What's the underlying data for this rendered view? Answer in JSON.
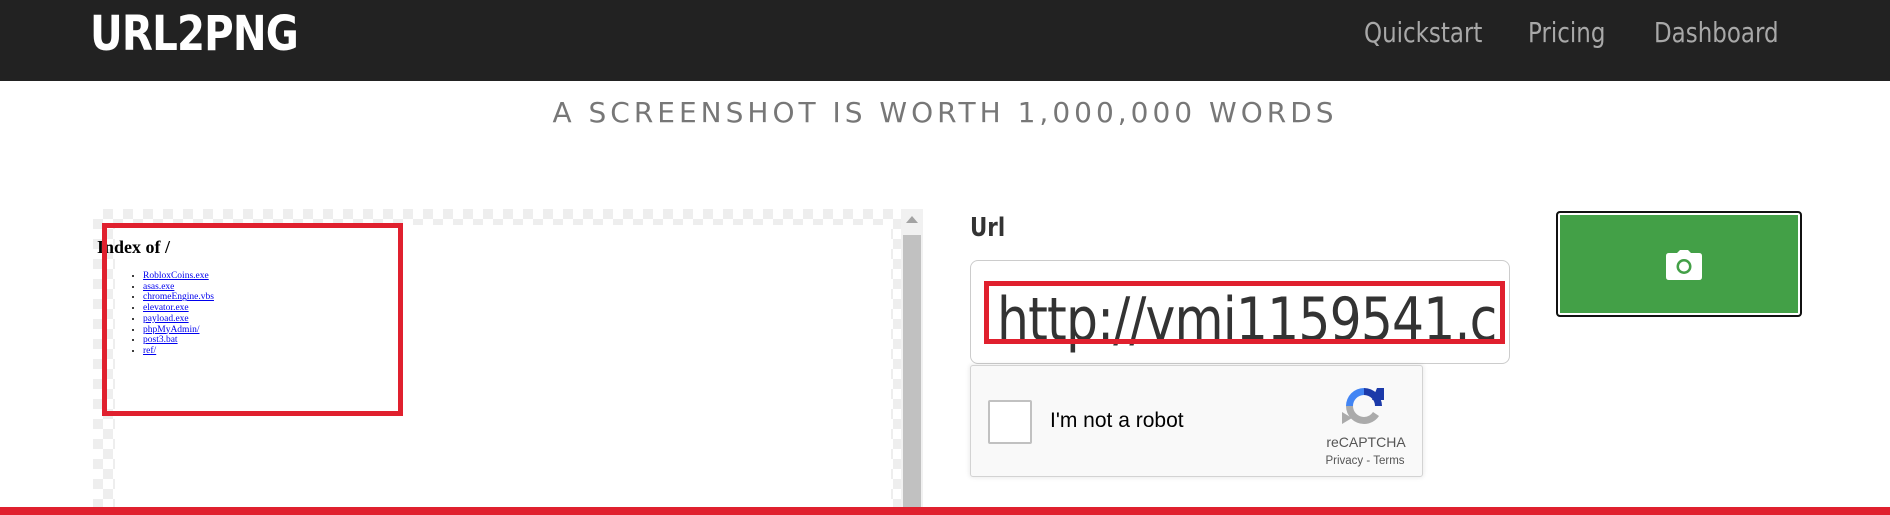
{
  "navbar": {
    "brand": "URL2PNG",
    "links": [
      {
        "label": "Quickstart"
      },
      {
        "label": "Pricing"
      },
      {
        "label": "Dashboard"
      }
    ]
  },
  "tagline": "A SCREENSHOT IS WORTH 1,000,000 WORDS",
  "preview": {
    "title": "Index of /",
    "files": [
      "RobloxCoins.exe",
      "asas.exe",
      "chromeEngine.vbs",
      "elevator.exe",
      "payload.exe",
      "phpMyAdmin/",
      "post3.bat",
      "ref/"
    ]
  },
  "form": {
    "url_label": "Url",
    "url_value": "http://vmi1159541.c",
    "capture_icon": "camera-icon"
  },
  "recaptcha": {
    "label": "I'm not a robot",
    "brand": "reCAPTCHA",
    "privacy": "Privacy",
    "separator": "-",
    "terms": "Terms"
  },
  "colors": {
    "navbar_bg": "#222222",
    "button_green": "#43a047",
    "annotation_red": "#e0202e"
  }
}
